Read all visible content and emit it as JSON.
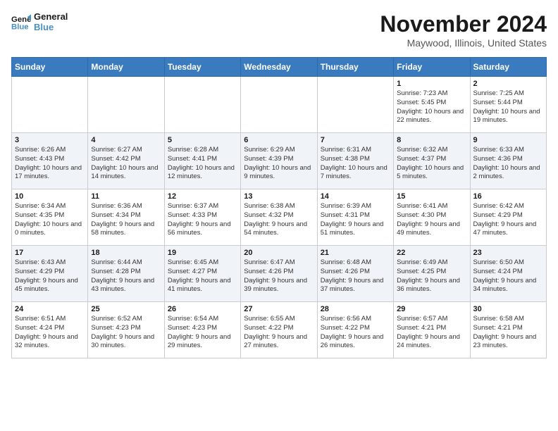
{
  "logo": {
    "text_general": "General",
    "text_blue": "Blue"
  },
  "header": {
    "month_title": "November 2024",
    "location": "Maywood, Illinois, United States"
  },
  "weekdays": [
    "Sunday",
    "Monday",
    "Tuesday",
    "Wednesday",
    "Thursday",
    "Friday",
    "Saturday"
  ],
  "weeks": [
    [
      {
        "day": "",
        "info": ""
      },
      {
        "day": "",
        "info": ""
      },
      {
        "day": "",
        "info": ""
      },
      {
        "day": "",
        "info": ""
      },
      {
        "day": "",
        "info": ""
      },
      {
        "day": "1",
        "info": "Sunrise: 7:23 AM\nSunset: 5:45 PM\nDaylight: 10 hours and 22 minutes."
      },
      {
        "day": "2",
        "info": "Sunrise: 7:25 AM\nSunset: 5:44 PM\nDaylight: 10 hours and 19 minutes."
      }
    ],
    [
      {
        "day": "3",
        "info": "Sunrise: 6:26 AM\nSunset: 4:43 PM\nDaylight: 10 hours and 17 minutes."
      },
      {
        "day": "4",
        "info": "Sunrise: 6:27 AM\nSunset: 4:42 PM\nDaylight: 10 hours and 14 minutes."
      },
      {
        "day": "5",
        "info": "Sunrise: 6:28 AM\nSunset: 4:41 PM\nDaylight: 10 hours and 12 minutes."
      },
      {
        "day": "6",
        "info": "Sunrise: 6:29 AM\nSunset: 4:39 PM\nDaylight: 10 hours and 9 minutes."
      },
      {
        "day": "7",
        "info": "Sunrise: 6:31 AM\nSunset: 4:38 PM\nDaylight: 10 hours and 7 minutes."
      },
      {
        "day": "8",
        "info": "Sunrise: 6:32 AM\nSunset: 4:37 PM\nDaylight: 10 hours and 5 minutes."
      },
      {
        "day": "9",
        "info": "Sunrise: 6:33 AM\nSunset: 4:36 PM\nDaylight: 10 hours and 2 minutes."
      }
    ],
    [
      {
        "day": "10",
        "info": "Sunrise: 6:34 AM\nSunset: 4:35 PM\nDaylight: 10 hours and 0 minutes."
      },
      {
        "day": "11",
        "info": "Sunrise: 6:36 AM\nSunset: 4:34 PM\nDaylight: 9 hours and 58 minutes."
      },
      {
        "day": "12",
        "info": "Sunrise: 6:37 AM\nSunset: 4:33 PM\nDaylight: 9 hours and 56 minutes."
      },
      {
        "day": "13",
        "info": "Sunrise: 6:38 AM\nSunset: 4:32 PM\nDaylight: 9 hours and 54 minutes."
      },
      {
        "day": "14",
        "info": "Sunrise: 6:39 AM\nSunset: 4:31 PM\nDaylight: 9 hours and 51 minutes."
      },
      {
        "day": "15",
        "info": "Sunrise: 6:41 AM\nSunset: 4:30 PM\nDaylight: 9 hours and 49 minutes."
      },
      {
        "day": "16",
        "info": "Sunrise: 6:42 AM\nSunset: 4:29 PM\nDaylight: 9 hours and 47 minutes."
      }
    ],
    [
      {
        "day": "17",
        "info": "Sunrise: 6:43 AM\nSunset: 4:29 PM\nDaylight: 9 hours and 45 minutes."
      },
      {
        "day": "18",
        "info": "Sunrise: 6:44 AM\nSunset: 4:28 PM\nDaylight: 9 hours and 43 minutes."
      },
      {
        "day": "19",
        "info": "Sunrise: 6:45 AM\nSunset: 4:27 PM\nDaylight: 9 hours and 41 minutes."
      },
      {
        "day": "20",
        "info": "Sunrise: 6:47 AM\nSunset: 4:26 PM\nDaylight: 9 hours and 39 minutes."
      },
      {
        "day": "21",
        "info": "Sunrise: 6:48 AM\nSunset: 4:26 PM\nDaylight: 9 hours and 37 minutes."
      },
      {
        "day": "22",
        "info": "Sunrise: 6:49 AM\nSunset: 4:25 PM\nDaylight: 9 hours and 36 minutes."
      },
      {
        "day": "23",
        "info": "Sunrise: 6:50 AM\nSunset: 4:24 PM\nDaylight: 9 hours and 34 minutes."
      }
    ],
    [
      {
        "day": "24",
        "info": "Sunrise: 6:51 AM\nSunset: 4:24 PM\nDaylight: 9 hours and 32 minutes."
      },
      {
        "day": "25",
        "info": "Sunrise: 6:52 AM\nSunset: 4:23 PM\nDaylight: 9 hours and 30 minutes."
      },
      {
        "day": "26",
        "info": "Sunrise: 6:54 AM\nSunset: 4:23 PM\nDaylight: 9 hours and 29 minutes."
      },
      {
        "day": "27",
        "info": "Sunrise: 6:55 AM\nSunset: 4:22 PM\nDaylight: 9 hours and 27 minutes."
      },
      {
        "day": "28",
        "info": "Sunrise: 6:56 AM\nSunset: 4:22 PM\nDaylight: 9 hours and 26 minutes."
      },
      {
        "day": "29",
        "info": "Sunrise: 6:57 AM\nSunset: 4:21 PM\nDaylight: 9 hours and 24 minutes."
      },
      {
        "day": "30",
        "info": "Sunrise: 6:58 AM\nSunset: 4:21 PM\nDaylight: 9 hours and 23 minutes."
      }
    ]
  ]
}
